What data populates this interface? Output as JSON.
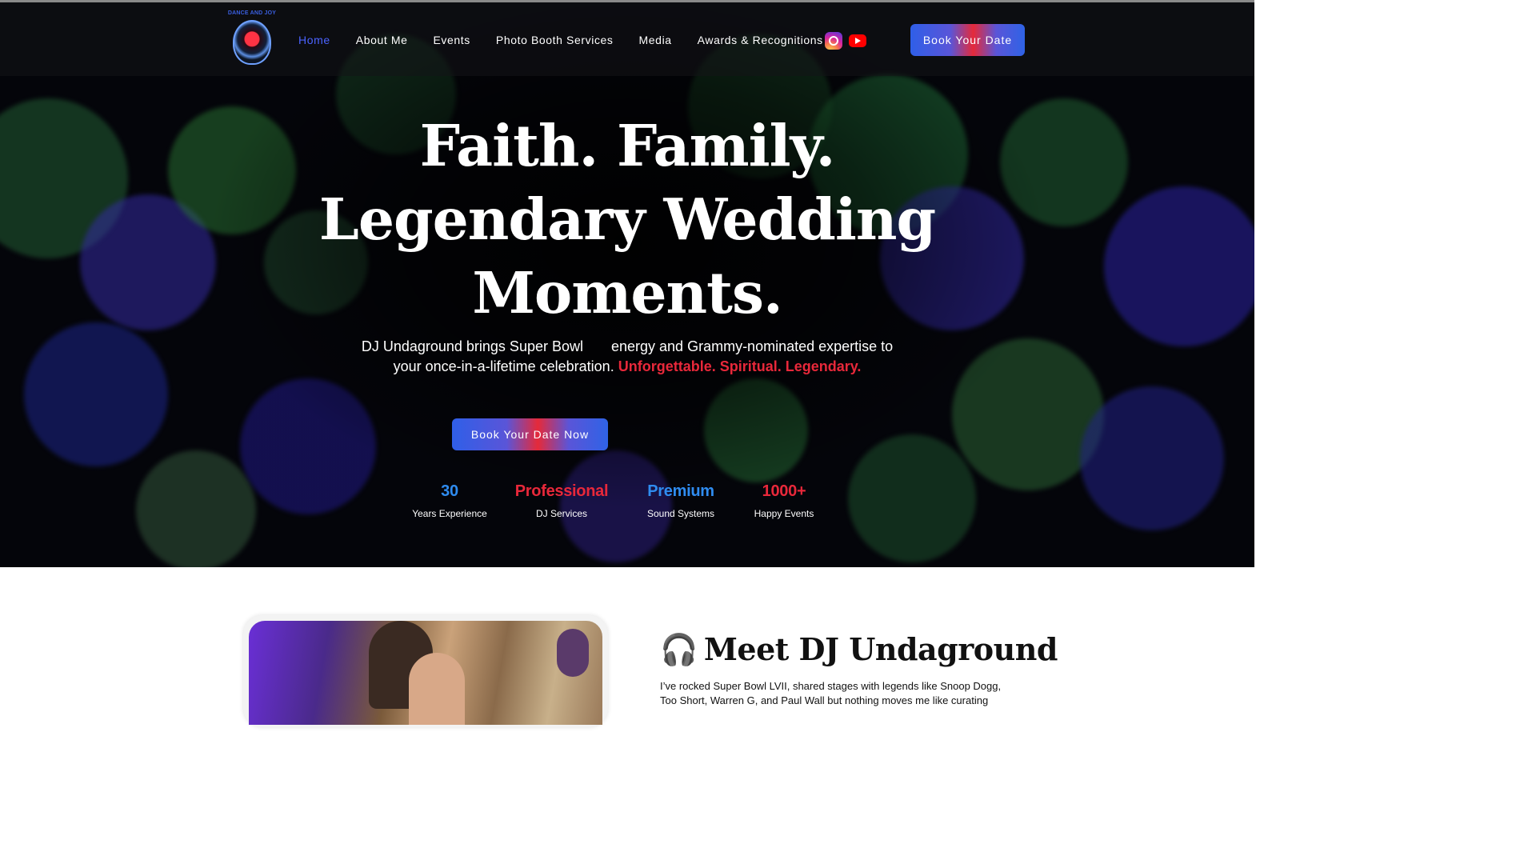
{
  "nav": {
    "logo_text": "DANCE AND JOY",
    "links": [
      {
        "label": "Home",
        "active": true
      },
      {
        "label": "About Me"
      },
      {
        "label": "Events"
      },
      {
        "label": "Photo Booth Services"
      },
      {
        "label": "Media"
      },
      {
        "label": "Awards & Recognitions"
      }
    ],
    "social": [
      "instagram-icon",
      "youtube-icon"
    ],
    "cta": "Book Your Date"
  },
  "hero": {
    "headline_1": "Faith. Family.",
    "headline_2": "Legendary Wedding",
    "headline_3": "Moments.",
    "sub_a": "DJ Undaground brings Super Bowl",
    "sub_b": "energy and Grammy-nominated expertise to your once-in-a-lifetime celebration.",
    "sub_red": "Unforgettable. Spiritual. Legendary.",
    "cta": "Book Your Date Now",
    "stats": [
      {
        "value": "30",
        "label": "Years Experience",
        "color": "#2f8cf0"
      },
      {
        "value": "Professional",
        "label": "DJ Services",
        "color": "#e8283a"
      },
      {
        "value": "Premium",
        "label": "Sound Systems",
        "color": "#2f8cf0"
      },
      {
        "value": "1000+",
        "label": "Happy Events",
        "color": "#e8283a"
      }
    ]
  },
  "about": {
    "icon": "headphones-icon",
    "title": "Meet DJ Undaground",
    "text": "I’ve rocked Super Bowl LVII, shared stages with legends like Snoop Dogg, Too Short, Warren G, and Paul Wall but nothing moves me like curating"
  },
  "colors": {
    "accent_blue": "#2f5fe8",
    "accent_red": "#e52a3a",
    "active_nav": "#4b63ff"
  }
}
